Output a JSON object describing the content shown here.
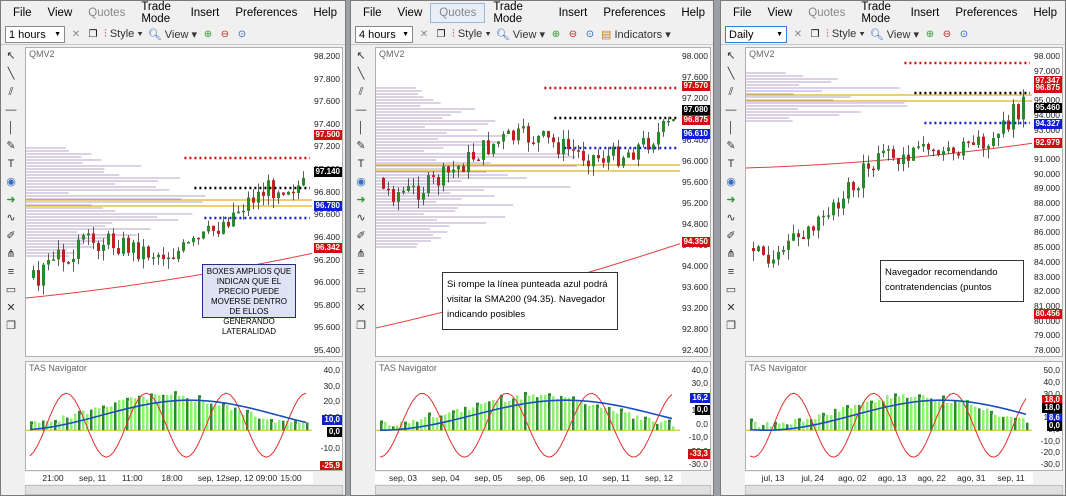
{
  "menu": [
    "File",
    "View",
    "Quotes",
    "Trade Mode",
    "Insert",
    "Preferences",
    "Help"
  ],
  "toolbar": {
    "style": "Style",
    "view": "View",
    "indicators": "Indicators"
  },
  "colors": {
    "bull": "#2a8a2a",
    "bear": "#c02020",
    "sma": "#e04040",
    "histo_pos": "#4caf50",
    "histo_light": "#90ee70",
    "nav_line": "#1a4ec0",
    "red_line": "#e03030"
  },
  "panes": [
    {
      "timeframe": "1 hours",
      "chart_title": "QMV2",
      "sub_title": "TAS Navigator",
      "y_ticks": [
        "98.200",
        "97.800",
        "97.600",
        "97.200",
        "96.800",
        "96.600",
        "96.200",
        "95.600",
        "95.400",
        "96.400",
        "96.000",
        "95.800"
      ],
      "y_labels": [
        {
          "text": "98.200",
          "y": 0.08
        },
        {
          "text": "97.800",
          "y": 0.16
        },
        {
          "text": "97.600",
          "y": 0.21
        },
        {
          "text": "97.400",
          "y": 0.27
        },
        {
          "text": "97.200",
          "y": 0.32
        },
        {
          "text": "97.000",
          "y": 0.42
        },
        {
          "text": "96.800",
          "y": 0.48
        },
        {
          "text": "96.600",
          "y": 0.59
        },
        {
          "text": "96.400",
          "y": 0.65
        },
        {
          "text": "96.200",
          "y": 0.71
        },
        {
          "text": "96.000",
          "y": 0.77
        },
        {
          "text": "95.800",
          "y": 0.83
        },
        {
          "text": "95.600",
          "y": 0.89
        },
        {
          "text": "95.400",
          "y": 0.95
        }
      ],
      "price_labels": [
        {
          "text": "97.500",
          "color": "#d01010",
          "y": 0.28
        },
        {
          "text": "97.140",
          "color": "#000000",
          "y": 0.4
        },
        {
          "text": "96.780",
          "color": "#1020d0",
          "y": 0.5
        },
        {
          "text": "96.342",
          "color": "#d01010",
          "y": 0.62
        }
      ],
      "sub_ticks": [
        "40,0",
        "30,0",
        "20,0",
        "10,0",
        "0,0",
        "-10,0",
        "-20,0"
      ],
      "sub_labels": [
        {
          "text": "10,0",
          "color": "#1020d0"
        },
        {
          "text": "0,0",
          "color": "#000000"
        },
        {
          "text": "-25,9",
          "color": "#d01010"
        }
      ],
      "x_ticks": [
        "21:00",
        "sep, 11",
        "11:00",
        "18:00",
        "sep, 12",
        "sep, 12 09:00",
        "15:00"
      ],
      "annotation": "BOXES AMPLIOS QUE INDICAN QUE EL PRECIO PUEDE MOVERSE DENTRO DE ELLOS GENERANDO LATERALIDAD"
    },
    {
      "timeframe": "4 hours",
      "chart_title": "QMV2",
      "sub_title": "TAS Navigator",
      "price_labels": [
        {
          "text": "97.570",
          "color": "#d01010"
        },
        {
          "text": "97.080",
          "color": "#000000"
        },
        {
          "text": "96.875",
          "color": "#d01010"
        },
        {
          "text": "96.610",
          "color": "#1020d0"
        },
        {
          "text": "94.350",
          "color": "#d01010"
        }
      ],
      "y_labels": [
        "98.000",
        "97.600",
        "97.200",
        "96.800",
        "96.400",
        "96.000",
        "95.600",
        "95.200",
        "94.800",
        "94.400",
        "94.000",
        "93.600",
        "93.200",
        "92.800",
        "92.400"
      ],
      "sub_ticks": [
        "40,0",
        "30,0",
        "20,0",
        "10,0",
        "0,0",
        "-10,0",
        "-20,0",
        "-30,0"
      ],
      "sub_labels": [
        {
          "text": "16,2",
          "color": "#1020d0"
        },
        {
          "text": "0,0",
          "color": "#000000"
        },
        {
          "text": "-33,3",
          "color": "#d01010"
        }
      ],
      "x_ticks": [
        "sep, 03",
        "sep, 04",
        "sep, 05",
        "sep, 06",
        "sep, 10",
        "sep, 11",
        "sep, 12"
      ],
      "annotation": "Si rompe la línea punteada azul podrá visitar la SMA200 (94.35). Navegador indicando posibles"
    },
    {
      "timeframe": "Daily",
      "chart_title": "QMV2",
      "sub_title": "TAS Navigator",
      "price_labels": [
        {
          "text": "97.347",
          "color": "#d01010"
        },
        {
          "text": "96.875",
          "color": "#d01010"
        },
        {
          "text": "95.460",
          "color": "#000000"
        },
        {
          "text": "94.327",
          "color": "#1020d0"
        },
        {
          "text": "92.979",
          "color": "#d01010"
        },
        {
          "text": "80.456",
          "color": "#d01010"
        }
      ],
      "y_labels": [
        "98.000",
        "97.000",
        "96.000",
        "95.000",
        "94.000",
        "93.000",
        "92.000",
        "91.000",
        "90.000",
        "89.000",
        "88.000",
        "87.000",
        "86.000",
        "85.000",
        "84.000",
        "83.000",
        "82.000",
        "81.000",
        "80.000",
        "79.000",
        "78.000"
      ],
      "sub_ticks": [
        "50,0",
        "40,0",
        "30,0",
        "20,0",
        "10,0",
        "0,0",
        "-10,0",
        "-20,0",
        "-30,0"
      ],
      "sub_labels": [
        {
          "text": "18,0",
          "color": "#d01010"
        },
        {
          "text": "18,0",
          "color": "#000000"
        },
        {
          "text": "8,6",
          "color": "#1020d0"
        },
        {
          "text": "0,0",
          "color": "#000000"
        }
      ],
      "x_ticks": [
        "jul, 13",
        "jul, 24",
        "ago, 02",
        "ago, 13",
        "ago, 22",
        "ago, 31",
        "sep, 11"
      ],
      "annotation": "Navegador recomendando contratendencias (puntos"
    }
  ]
}
